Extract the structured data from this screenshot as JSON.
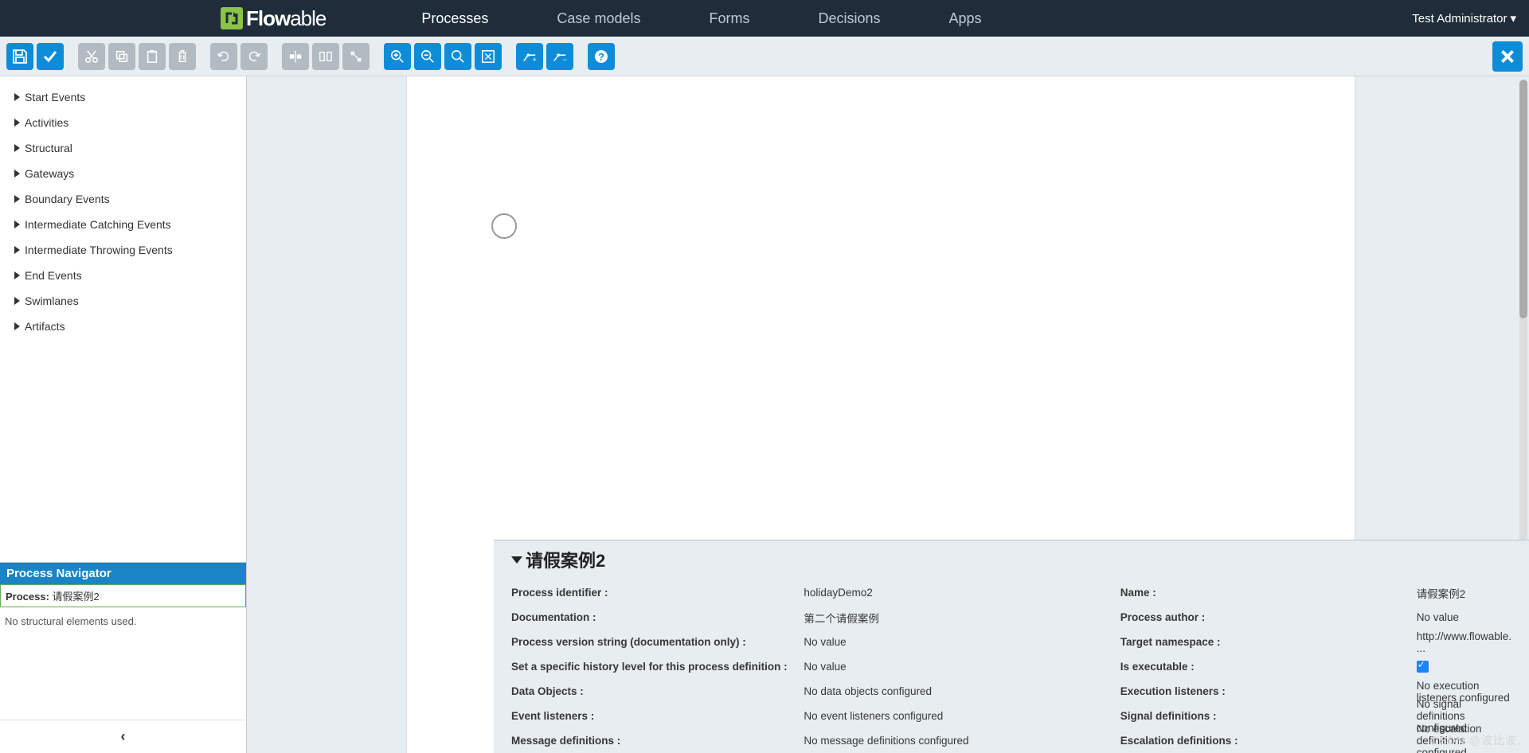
{
  "logo": "Flowable",
  "navbar": {
    "items": [
      "Processes",
      "Case models",
      "Forms",
      "Decisions",
      "Apps"
    ],
    "active_index": 0,
    "user": "Test Administrator"
  },
  "toolbar": {
    "save": "save",
    "validate": "validate",
    "cut": "cut",
    "copy": "copy",
    "paste": "paste",
    "delete": "delete",
    "redo": "redo",
    "undo": "undo",
    "align_v": "align-vertical",
    "same_size": "same-size",
    "align_h": "align-horizontal",
    "zoom_in": "zoom-in",
    "zoom_out": "zoom-out",
    "zoom_actual": "zoom-actual",
    "zoom_fit": "zoom-fit",
    "bendpoint_add": "bendpoint-add",
    "bendpoint_remove": "bendpoint-remove",
    "help": "help",
    "close": "close"
  },
  "palette": {
    "items": [
      "Start Events",
      "Activities",
      "Structural",
      "Gateways",
      "Boundary Events",
      "Intermediate Catching Events",
      "Intermediate Throwing Events",
      "End Events",
      "Swimlanes",
      "Artifacts"
    ]
  },
  "navigator": {
    "title": "Process Navigator",
    "process_label": "Process:",
    "process_name": "请假案例2",
    "empty_text": "No structural elements used.",
    "collapse": "‹"
  },
  "props": {
    "title": "请假案例2",
    "left": [
      {
        "label": "Process identifier :",
        "value": "holidayDemo2"
      },
      {
        "label": "Documentation :",
        "value": "第二个请假案例"
      },
      {
        "label": "Process version string (documentation only) :",
        "value": "No value"
      },
      {
        "label": "Set a specific history level for this process definition :",
        "value": "No value"
      },
      {
        "label": "Data Objects :",
        "value": "No data objects configured"
      },
      {
        "label": "Event listeners :",
        "value": "No event listeners configured"
      },
      {
        "label": "Message definitions :",
        "value": "No message definitions configured"
      }
    ],
    "right": [
      {
        "label": "Name :",
        "value": "请假案例2"
      },
      {
        "label": "Process author :",
        "value": "No value"
      },
      {
        "label": "Target namespace :",
        "value": "http://www.flowable. ..."
      },
      {
        "label": "Is executable :",
        "value": "__checkbox__"
      },
      {
        "label": "Execution listeners :",
        "value": "No execution listeners configured"
      },
      {
        "label": "Signal definitions :",
        "value": "No signal definitions configured"
      },
      {
        "label": "Escalation definitions :",
        "value": "No escalation definitions configured"
      }
    ]
  },
  "watermark": "CSDN @波比波,"
}
